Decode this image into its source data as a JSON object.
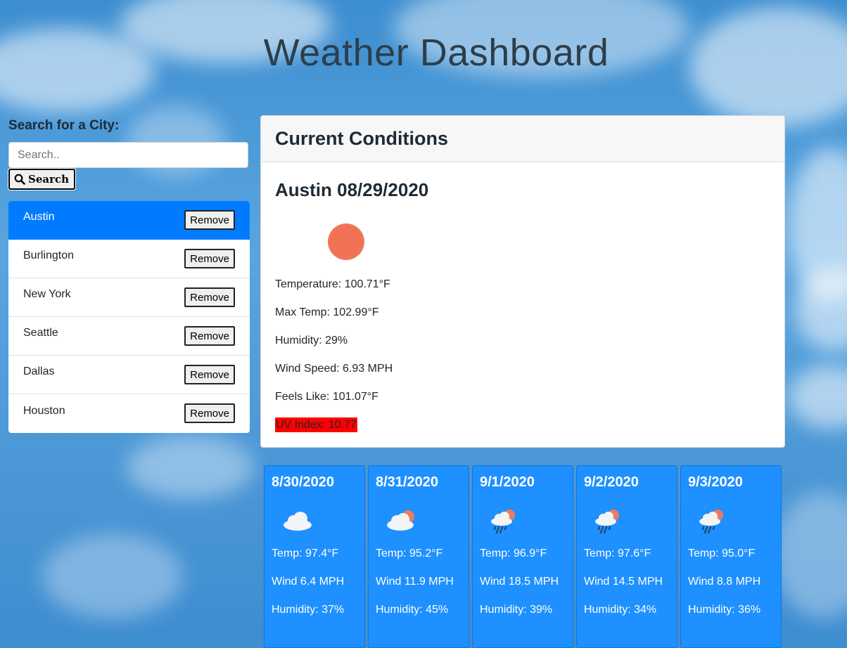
{
  "app": {
    "title": "Weather Dashboard"
  },
  "search": {
    "label": "Search for a City:",
    "placeholder": "Search..",
    "button_label": "Search"
  },
  "cities": [
    {
      "name": "Austin",
      "remove_label": "Remove",
      "active": true
    },
    {
      "name": "Burlington",
      "remove_label": "Remove"
    },
    {
      "name": "New York",
      "remove_label": "Remove"
    },
    {
      "name": "Seattle",
      "remove_label": "Remove"
    },
    {
      "name": "Dallas",
      "remove_label": "Remove"
    },
    {
      "name": "Houston",
      "remove_label": "Remove"
    }
  ],
  "current": {
    "header": "Current Conditions",
    "city_date": "Austin 08/29/2020",
    "icon": "sun-icon",
    "temperature": "Temperature: 100.71°F",
    "max_temp": "Max Temp: 102.99°F",
    "humidity": "Humidity: 29%",
    "wind": "Wind Speed: 6.93 MPH",
    "feels_like": "Feels Like: 101.07°F",
    "uv": "UV Index: 10.77",
    "uv_color": "#ff0000"
  },
  "forecast": [
    {
      "date": "8/30/2020",
      "icon": "cloud-icon",
      "temp": "Temp: 97.4°F",
      "wind": "Wind 6.4 MPH",
      "humidity": "Humidity: 37%"
    },
    {
      "date": "8/31/2020",
      "icon": "partly-cloudy-icon",
      "temp": "Temp: 95.2°F",
      "wind": "Wind 11.9 MPH",
      "humidity": "Humidity: 45%"
    },
    {
      "date": "9/1/2020",
      "icon": "rain-sun-icon",
      "temp": "Temp: 96.9°F",
      "wind": "Wind 18.5 MPH",
      "humidity": "Humidity: 39%"
    },
    {
      "date": "9/2/2020",
      "icon": "rain-sun-icon",
      "temp": "Temp: 97.6°F",
      "wind": "Wind 14.5 MPH",
      "humidity": "Humidity: 34%"
    },
    {
      "date": "9/3/2020",
      "icon": "rain-sun-icon",
      "temp": "Temp: 95.0°F",
      "wind": "Wind 8.8 MPH",
      "humidity": "Humidity: 36%"
    }
  ],
  "colors": {
    "accent": "#007bff",
    "forecast_bg": "#1e90ff"
  }
}
